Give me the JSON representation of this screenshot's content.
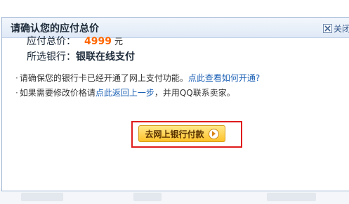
{
  "dialog": {
    "title": "请确认您的应付总价",
    "close_label": "关闭"
  },
  "payment": {
    "total_label": "应付总价：",
    "total_value": "4999",
    "total_unit": "元",
    "bank_label": "所选银行：",
    "bank_value": "银联在线支付"
  },
  "notes": {
    "line1_prefix": "请确保您的银行卡已经开通了网上支付功能。",
    "line1_link": "点此查看如何开通?",
    "line2_prefix": "如果需要修改价格请",
    "line2_link": "点此返回上一步",
    "line2_suffix": "，并用QQ联系卖家。"
  },
  "actions": {
    "pay_label": "去网上银行付款"
  },
  "colors": {
    "amount": "#ff6600",
    "link": "#1a5fb4",
    "highlight": "#e01c1c"
  }
}
